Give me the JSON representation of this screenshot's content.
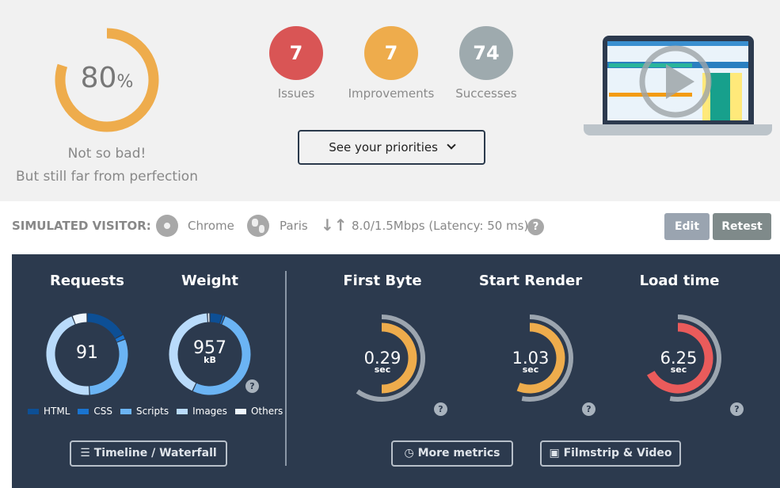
{
  "score": {
    "value": "80",
    "unit": "%",
    "percent": 80,
    "line1": "Not so bad!",
    "line2": "But still far from perfection",
    "color": "#eeac4c"
  },
  "summary": [
    {
      "count": "7",
      "label": "Issues",
      "color": "#d95555"
    },
    {
      "count": "7",
      "label": "Improvements",
      "color": "#eeac4c"
    },
    {
      "count": "74",
      "label": "Successes",
      "color": "#9eaaae"
    }
  ],
  "priorities_label": "See your priorities",
  "video": {
    "icon": "play-icon"
  },
  "visitor": {
    "label": "SIMULATED VISITOR:",
    "browser": "Chrome",
    "location": "Paris",
    "connection": "8.0/1.5Mbps (Latency: 50 ms)",
    "edit": "Edit",
    "retest": "Retest"
  },
  "panel": {
    "requests": {
      "title": "Requests",
      "value": "91",
      "segments": [
        17,
        2,
        30,
        45,
        6
      ]
    },
    "weight": {
      "title": "Weight",
      "value": "957",
      "unit": "kB",
      "segments": [
        5,
        1,
        51,
        42,
        1
      ]
    },
    "legend": [
      {
        "label": "HTML",
        "color": "#0d4f95"
      },
      {
        "label": "CSS",
        "color": "#1a74d0"
      },
      {
        "label": "Scripts",
        "color": "#6bb4f4"
      },
      {
        "label": "Images",
        "color": "#b9dbfb"
      },
      {
        "label": "Others",
        "color": "#eef6fe"
      }
    ],
    "metrics": [
      {
        "title": "First Byte",
        "value": "0.29",
        "unit": "sec",
        "fill": 50,
        "ref": 60,
        "color": "#eeac4c"
      },
      {
        "title": "Start Render",
        "value": "1.03",
        "unit": "sec",
        "fill": 56,
        "ref": 53,
        "color": "#eeac4c"
      },
      {
        "title": "Load time",
        "value": "6.25",
        "unit": "sec",
        "fill": 67,
        "ref": 53,
        "color": "#ea5b5b"
      }
    ],
    "timeline_label": "Timeline / Waterfall",
    "more_metrics_label": "More metrics",
    "filmstrip_label": "Filmstrip & Video"
  }
}
